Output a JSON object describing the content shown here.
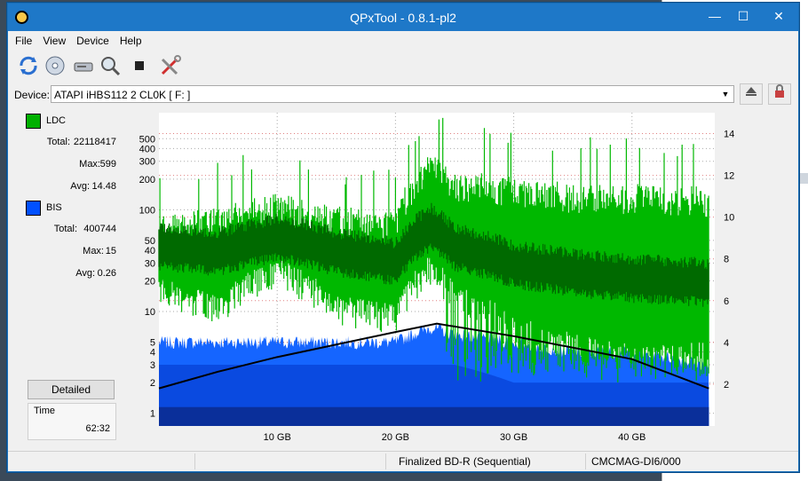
{
  "window": {
    "title": "QPxTool - 0.8.1-pl2",
    "controls": {
      "minimize": "—",
      "maximize": "☐",
      "close": "✕"
    }
  },
  "menu": [
    "File",
    "View",
    "Device",
    "Help"
  ],
  "toolbar": {
    "icons": [
      "refresh-icon",
      "disc-icon",
      "drive-icon",
      "scan-icon",
      "stop-icon",
      "settings-tools-icon"
    ]
  },
  "device": {
    "label": "Device:",
    "value": "ATAPI   iHBS112   2     CL0K [ F: ]"
  },
  "legend": {
    "ldc": {
      "name": "LDC",
      "color": "#00b000",
      "total_label": "Total:",
      "total": "22118417",
      "max_label": "Max:",
      "max": "599",
      "avg_label": "Avg:",
      "avg": "14.48"
    },
    "bis": {
      "name": "BIS",
      "color": "#0050ff",
      "total_label": "Total:",
      "total": "400744",
      "max_label": "Max:",
      "max": "15",
      "avg_label": "Avg:",
      "avg": "0.26"
    }
  },
  "detailed_button": "Detailed",
  "time": {
    "label": "Time",
    "value": "62:32"
  },
  "status": {
    "cell1": "",
    "cell2": "",
    "disc_type": "Finalized BD-R (Sequential)",
    "media_id": "CMCMAG-DI6/000"
  },
  "chart_data": {
    "type": "area",
    "x_ticks": [
      10,
      20,
      30,
      40
    ],
    "x_tick_labels": [
      "10 GB",
      "20 GB",
      "30 GB",
      "40 GB"
    ],
    "xlim": [
      0,
      47
    ],
    "y_left_scale": "log",
    "y_left_ticks": [
      1,
      2,
      3,
      4,
      5,
      10,
      20,
      30,
      40,
      50,
      100,
      200,
      300,
      400,
      500
    ],
    "ylim_left": [
      0.75,
      900
    ],
    "y_right_ticks": [
      2,
      4,
      6,
      8,
      10,
      12,
      14
    ],
    "ylim_right": [
      0,
      15
    ],
    "grid": true,
    "series": [
      {
        "name": "LDC",
        "color": "#00b000",
        "x": [
          0,
          5,
          10,
          15,
          20,
          23,
          25,
          30,
          35,
          40,
          46.5
        ],
        "max": [
          80,
          90,
          120,
          90,
          80,
          300,
          200,
          180,
          150,
          150,
          140
        ],
        "avg": [
          45,
          40,
          55,
          40,
          32,
          70,
          45,
          30,
          25,
          22,
          20
        ],
        "min": [
          18,
          12,
          28,
          12,
          10,
          30,
          15,
          8,
          5,
          4,
          3
        ]
      },
      {
        "name": "BIS",
        "color": "#0050ff",
        "x": [
          0,
          5,
          10,
          15,
          20,
          23,
          25,
          30,
          35,
          40,
          46.5
        ],
        "max": [
          5,
          5,
          5,
          5,
          5,
          7,
          6,
          5,
          4,
          4,
          3
        ],
        "avg": [
          3,
          3,
          3,
          3,
          3,
          3,
          3,
          2,
          2,
          2,
          2
        ]
      },
      {
        "name": "Speed",
        "color": "#000000",
        "axis": "right",
        "x": [
          0,
          5,
          10,
          15,
          20,
          23.5,
          30,
          40,
          46.5
        ],
        "values": [
          1.8,
          2.6,
          3.3,
          3.9,
          4.5,
          4.9,
          4.3,
          3.2,
          1.8
        ]
      }
    ]
  }
}
